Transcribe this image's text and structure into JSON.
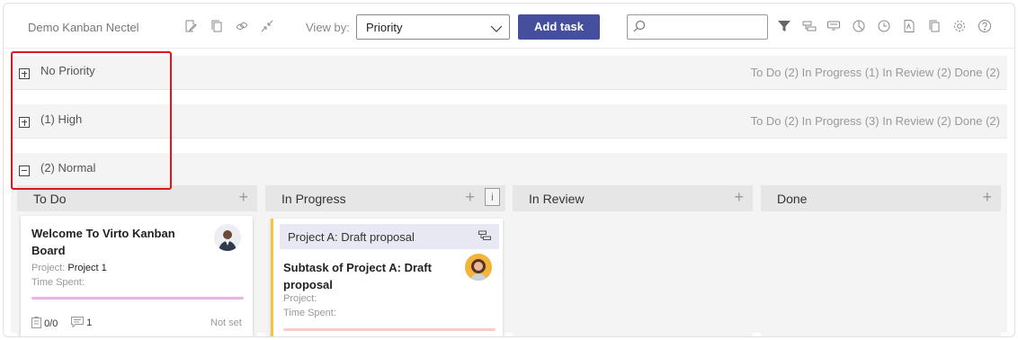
{
  "toolbar": {
    "title": "Demo Kanban Nectel",
    "view_by_label": "View by:",
    "view_by_value": "Priority",
    "add_task_label": "Add task",
    "search_placeholder": "",
    "icons_left": [
      "edit-icon",
      "copy-icon",
      "link-icon",
      "collapse-icon"
    ],
    "icons_right": [
      "filter-icon",
      "subtask-icon",
      "card-view-icon",
      "chart-icon",
      "history-icon",
      "pdf-icon",
      "duplicate-icon",
      "settings-icon",
      "help-icon"
    ]
  },
  "groups": [
    {
      "label": "No Priority",
      "expanded": false,
      "stats": "To Do (2) In Progress (1) In Review (2) Done (2)"
    },
    {
      "label": "(1) High",
      "expanded": false,
      "stats": "To Do (2) In Progress (3) In Review (2) Done (2)"
    },
    {
      "label": "(2) Normal",
      "expanded": true,
      "stats": ""
    }
  ],
  "columns": [
    {
      "title": "To Do"
    },
    {
      "title": "In Progress",
      "info": "i"
    },
    {
      "title": "In Review"
    },
    {
      "title": "Done"
    }
  ],
  "cards": {
    "todo_card": {
      "title_line1": "Welcome To Virto Kanban",
      "title_line2": "Board",
      "project_label": "Project:",
      "project_value": "Project 1",
      "time_label": "Time Spent:",
      "checklist": "0/0",
      "comments": "1",
      "due": "Not set",
      "progress_color": "#e9b4ea"
    },
    "inprogress_card": {
      "parent_title": "Project A: Draft proposal",
      "title_line1": "Subtask of Project A: Draft",
      "title_line2": "proposal",
      "project_label": "Project:",
      "time_label": "Time Spent:",
      "progress_color": "#ffc9c9",
      "accent_color": "#f4c542"
    }
  },
  "colors": {
    "primary": "#464f9e",
    "highlight": "#e0141e",
    "group_bg": "#f4f4f4"
  }
}
